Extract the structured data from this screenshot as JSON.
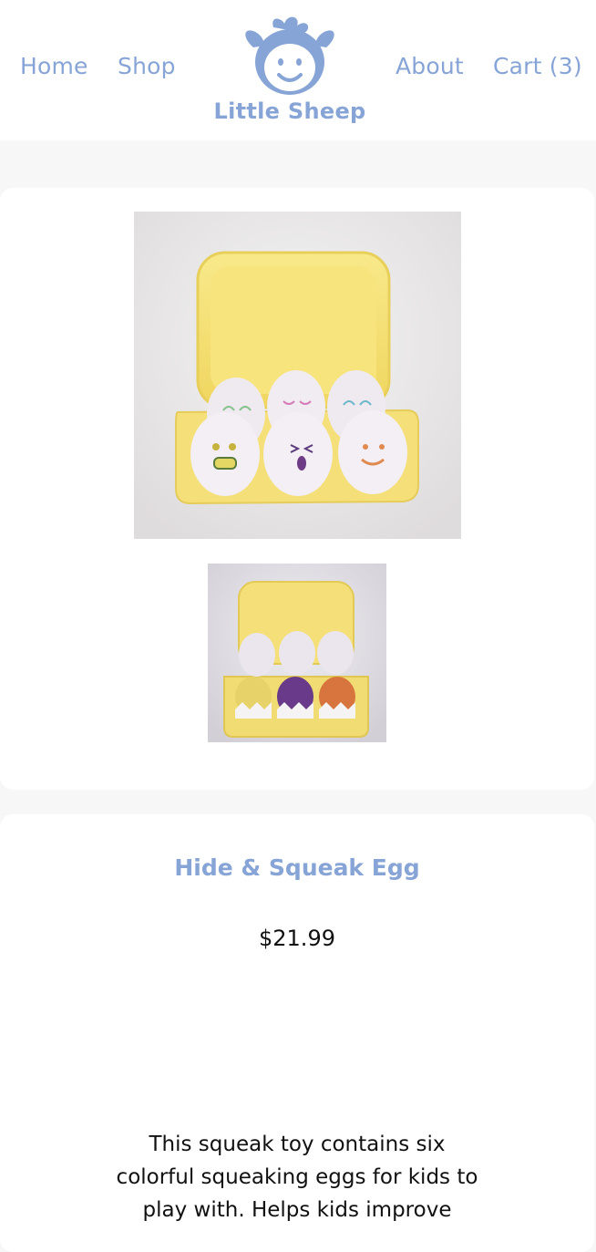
{
  "nav": {
    "home": "Home",
    "shop": "Shop",
    "about": "About",
    "cart": "Cart (3)"
  },
  "logo": {
    "text": "Little Sheep",
    "icon": "sheep-face-icon"
  },
  "colors": {
    "brand": "#87a4d6",
    "page_bg": "#f7f7f7",
    "card_bg": "#ffffff",
    "text": "#111111"
  },
  "product": {
    "title": "Hide & Squeak Egg",
    "price": "$21.99",
    "description": "This squeak toy contains six colorful squeaking eggs for kids to play with. Helps kids improve"
  }
}
